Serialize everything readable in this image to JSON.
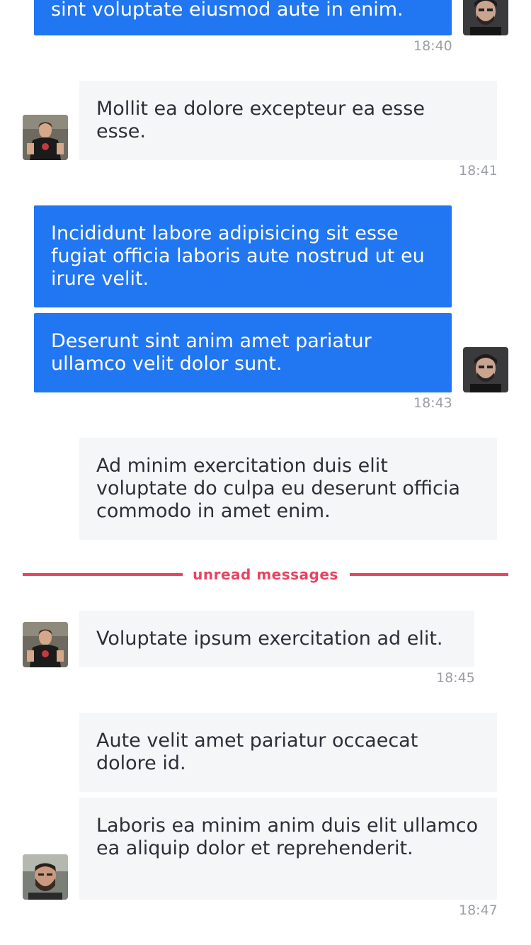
{
  "colors": {
    "outgoing_bubble": "#2176f2",
    "incoming_bubble": "#f5f6f8",
    "unread_accent": "#ea4360",
    "timestamp": "#9b9ea6"
  },
  "messages": [
    {
      "direction": "out",
      "text": "sint voluptate eiusmod aute in enim."
    },
    {
      "direction": "in",
      "text": "Mollit ea dolore excepteur ea esse esse."
    },
    {
      "direction": "out",
      "text": "Incididunt labore adipisicing sit esse fugiat officia laboris aute nostrud ut eu irure velit."
    },
    {
      "direction": "out",
      "text": "Deserunt sint anim amet pariatur ullamco velit dolor sunt."
    },
    {
      "direction": "in",
      "text": "Ad minim exercitation duis elit voluptate do culpa eu deserunt officia commodo in amet enim."
    },
    {
      "direction": "in",
      "text": "Voluptate ipsum exercitation ad elit."
    },
    {
      "direction": "in",
      "text": "Aute velit amet pariatur occaecat dolore id."
    },
    {
      "direction": "in",
      "text": "Laboris ea minim anim duis elit ullamco ea aliquip dolor et reprehenderit."
    }
  ],
  "timestamps": [
    "18:40",
    "18:41",
    "18:43",
    "18:45",
    "18:47"
  ],
  "divider": {
    "label": "unread messages"
  },
  "avatars": [
    "dark-hair-man-avatar",
    "young-man-avatar",
    "bearded-man-avatar"
  ]
}
